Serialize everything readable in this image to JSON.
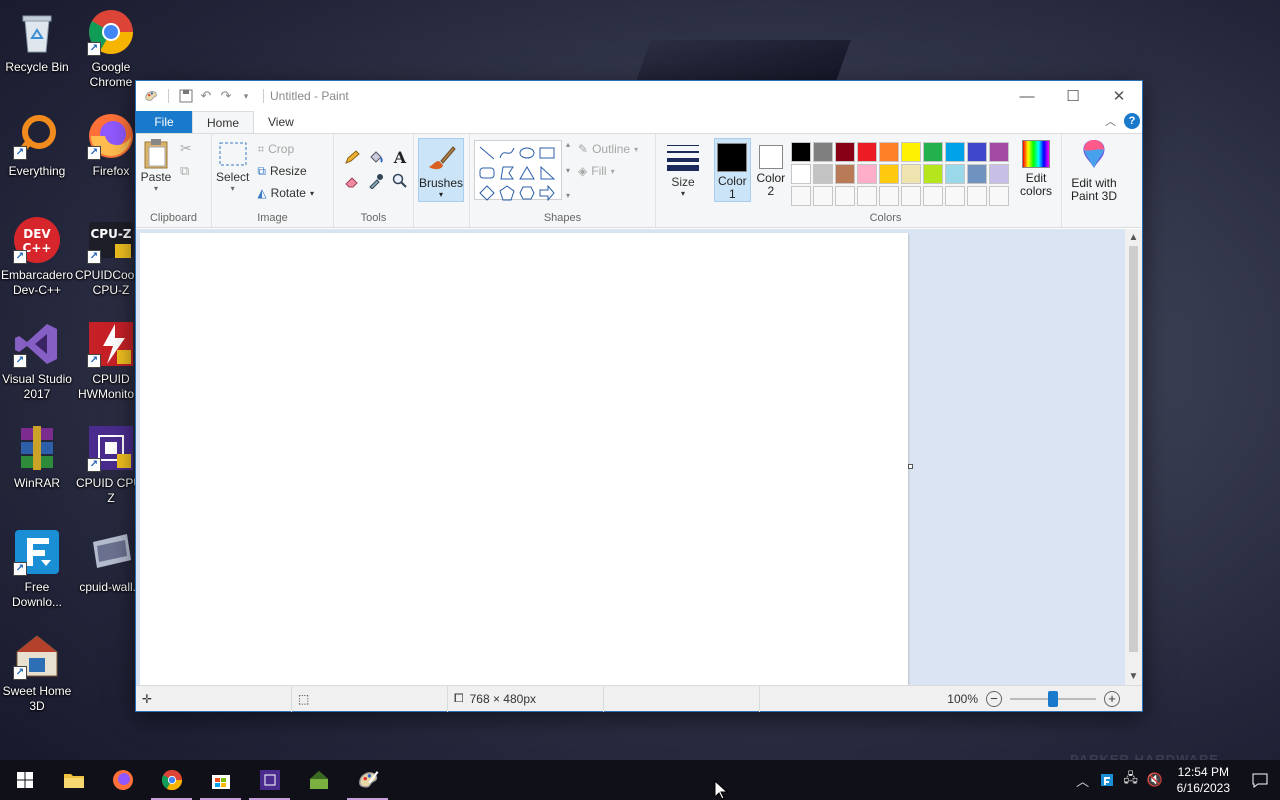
{
  "desktop": {
    "icons": [
      {
        "label": "Recycle Bin",
        "icon": "recycle-bin-icon",
        "color": "#cfd8e3"
      },
      {
        "label": "Google Chrome",
        "icon": "chrome-icon",
        "color": "#db4437"
      },
      {
        "label": "Everything",
        "icon": "everything-search-icon",
        "color": "#f28b1e"
      },
      {
        "label": "Firefox",
        "icon": "firefox-icon",
        "color": "#ff7139"
      },
      {
        "label": "Embarcadero Dev-C++",
        "icon": "devcpp-icon",
        "color": "#d7262b"
      },
      {
        "label": "CPUIDCool... CPU-Z",
        "icon": "cpuz-icon",
        "color": "#1e1e28"
      },
      {
        "label": "Visual Studio 2017",
        "icon": "visual-studio-icon",
        "color": "#68217a"
      },
      {
        "label": "CPUID HWMonito...",
        "icon": "hwmonitor-icon",
        "color": "#c62127"
      },
      {
        "label": "WinRAR",
        "icon": "winrar-icon",
        "color": "#7b2c8e"
      },
      {
        "label": "CPUID CPU-Z",
        "icon": "cpuid-cpuz-icon",
        "color": "#4a2c8e"
      },
      {
        "label": "Free Downlo...",
        "icon": "free-download-manager-icon",
        "color": "#1a8fd6"
      },
      {
        "label": "cpuid-wall...",
        "icon": "wallpaper-file-icon",
        "color": "#8a8fa8"
      },
      {
        "label": "Sweet Home 3D",
        "icon": "sweet-home-3d-icon",
        "color": "#b3412b"
      }
    ],
    "watermark": "PARKER HARDWARE"
  },
  "window": {
    "title": "Untitled - Paint",
    "tabs": {
      "file": "File",
      "home": "Home",
      "view": "View"
    },
    "help": "?",
    "ribbon": {
      "clipboard": {
        "label": "Clipboard",
        "paste": "Paste"
      },
      "image": {
        "label": "Image",
        "select": "Select",
        "crop": "Crop",
        "resize": "Resize",
        "rotate": "Rotate"
      },
      "tools": {
        "label": "Tools"
      },
      "brushes": "Brushes",
      "shapes": {
        "label": "Shapes",
        "outline": "Outline",
        "fill": "Fill"
      },
      "size": "Size",
      "colors": {
        "label": "Colors",
        "color1": "Color 1",
        "color2": "Color 2",
        "color1_value": "#000000",
        "color2_value": "#ffffff",
        "edit_colors": "Edit colors",
        "palette": [
          "#000000",
          "#7f7f7f",
          "#880015",
          "#ed1c24",
          "#ff7f27",
          "#fff200",
          "#22b14c",
          "#00a2e8",
          "#3f48cc",
          "#a349a4",
          "#ffffff",
          "#c3c3c3",
          "#b97a57",
          "#ffaec9",
          "#ffc90e",
          "#efe4b0",
          "#b5e61d",
          "#99d9ea",
          "#7092be",
          "#c8bfe7",
          "#f8f8f8",
          "#f8f8f8",
          "#f8f8f8",
          "#f8f8f8",
          "#f8f8f8",
          "#f8f8f8",
          "#f8f8f8",
          "#f8f8f8",
          "#f8f8f8",
          "#f8f8f8"
        ]
      },
      "edit_paint3d": "Edit with Paint 3D"
    },
    "status": {
      "canvas_size": "768 × 480px",
      "zoom": "100%",
      "zoom_fraction": 0.5
    }
  },
  "taskbar": {
    "apps": [
      "windows-start-icon",
      "file-explorer-icon",
      "firefox-icon",
      "chrome-icon",
      "microsoft-store-icon",
      "cpuz-icon",
      "sweet-home-3d-icon",
      "paint-icon"
    ],
    "time": "12:54 PM",
    "date": "6/16/2023"
  }
}
